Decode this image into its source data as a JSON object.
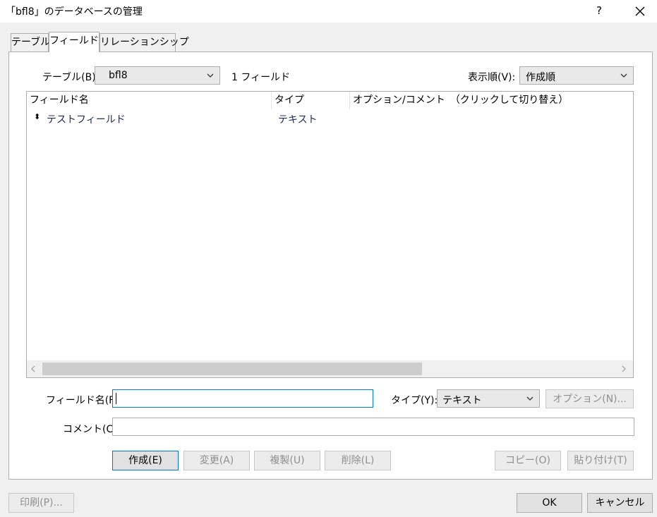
{
  "window": {
    "title": "「bfl8」のデータベースの管理",
    "help_label": "?"
  },
  "tabs": [
    {
      "label": "テーブル",
      "active": false
    },
    {
      "label": "フィールド",
      "active": true
    },
    {
      "label": "リレーションシップ",
      "active": false
    }
  ],
  "table_selector": {
    "label": "テーブル(B):",
    "value": "bfl8",
    "field_count": "1 フィールド"
  },
  "sort_selector": {
    "label": "表示順(V):",
    "value": "作成順"
  },
  "fields_list": {
    "columns": [
      "フィールド名",
      "タイプ",
      "オプション/コメント　（クリックして切り替え）"
    ],
    "rows": [
      {
        "name": "テストフィールド",
        "type": "テキスト",
        "options": ""
      }
    ],
    "row_marker": "⬍"
  },
  "field_form": {
    "name_label": "フィールド名(F):",
    "name_value": "",
    "type_label": "タイプ(Y):",
    "type_value": "テキスト",
    "options_button": "オプション(N)...",
    "comment_label": "コメント(C):",
    "comment_value": ""
  },
  "actions": {
    "create": "作成(E)",
    "change": "変更(A)",
    "duplicate": "複製(U)",
    "delete": "削除(L)",
    "copy": "コピー(O)",
    "paste": "貼り付け(T)"
  },
  "footer": {
    "print": "印刷(P)...",
    "ok": "OK",
    "cancel": "キャンセル"
  }
}
